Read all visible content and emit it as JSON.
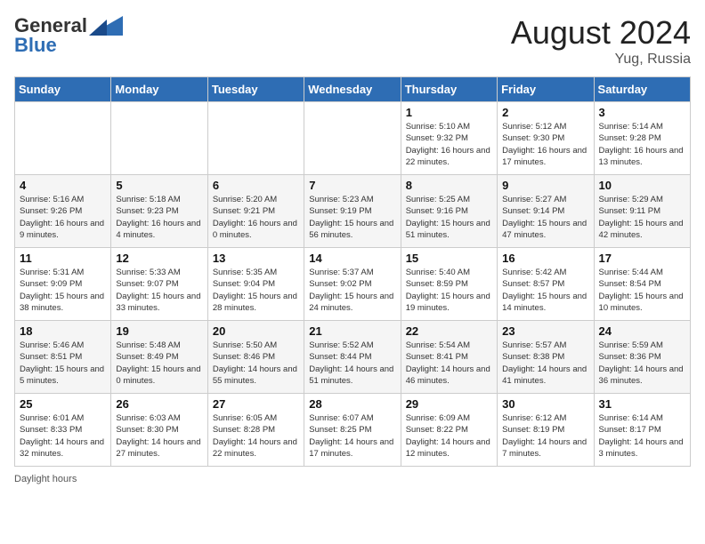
{
  "header": {
    "logo_general": "General",
    "logo_blue": "Blue",
    "month_year": "August 2024",
    "location": "Yug, Russia"
  },
  "days_of_week": [
    "Sunday",
    "Monday",
    "Tuesday",
    "Wednesday",
    "Thursday",
    "Friday",
    "Saturday"
  ],
  "weeks": [
    [
      {
        "day": "",
        "info": ""
      },
      {
        "day": "",
        "info": ""
      },
      {
        "day": "",
        "info": ""
      },
      {
        "day": "",
        "info": ""
      },
      {
        "day": "1",
        "info": "Sunrise: 5:10 AM\nSunset: 9:32 PM\nDaylight: 16 hours and 22 minutes."
      },
      {
        "day": "2",
        "info": "Sunrise: 5:12 AM\nSunset: 9:30 PM\nDaylight: 16 hours and 17 minutes."
      },
      {
        "day": "3",
        "info": "Sunrise: 5:14 AM\nSunset: 9:28 PM\nDaylight: 16 hours and 13 minutes."
      }
    ],
    [
      {
        "day": "4",
        "info": "Sunrise: 5:16 AM\nSunset: 9:26 PM\nDaylight: 16 hours and 9 minutes."
      },
      {
        "day": "5",
        "info": "Sunrise: 5:18 AM\nSunset: 9:23 PM\nDaylight: 16 hours and 4 minutes."
      },
      {
        "day": "6",
        "info": "Sunrise: 5:20 AM\nSunset: 9:21 PM\nDaylight: 16 hours and 0 minutes."
      },
      {
        "day": "7",
        "info": "Sunrise: 5:23 AM\nSunset: 9:19 PM\nDaylight: 15 hours and 56 minutes."
      },
      {
        "day": "8",
        "info": "Sunrise: 5:25 AM\nSunset: 9:16 PM\nDaylight: 15 hours and 51 minutes."
      },
      {
        "day": "9",
        "info": "Sunrise: 5:27 AM\nSunset: 9:14 PM\nDaylight: 15 hours and 47 minutes."
      },
      {
        "day": "10",
        "info": "Sunrise: 5:29 AM\nSunset: 9:11 PM\nDaylight: 15 hours and 42 minutes."
      }
    ],
    [
      {
        "day": "11",
        "info": "Sunrise: 5:31 AM\nSunset: 9:09 PM\nDaylight: 15 hours and 38 minutes."
      },
      {
        "day": "12",
        "info": "Sunrise: 5:33 AM\nSunset: 9:07 PM\nDaylight: 15 hours and 33 minutes."
      },
      {
        "day": "13",
        "info": "Sunrise: 5:35 AM\nSunset: 9:04 PM\nDaylight: 15 hours and 28 minutes."
      },
      {
        "day": "14",
        "info": "Sunrise: 5:37 AM\nSunset: 9:02 PM\nDaylight: 15 hours and 24 minutes."
      },
      {
        "day": "15",
        "info": "Sunrise: 5:40 AM\nSunset: 8:59 PM\nDaylight: 15 hours and 19 minutes."
      },
      {
        "day": "16",
        "info": "Sunrise: 5:42 AM\nSunset: 8:57 PM\nDaylight: 15 hours and 14 minutes."
      },
      {
        "day": "17",
        "info": "Sunrise: 5:44 AM\nSunset: 8:54 PM\nDaylight: 15 hours and 10 minutes."
      }
    ],
    [
      {
        "day": "18",
        "info": "Sunrise: 5:46 AM\nSunset: 8:51 PM\nDaylight: 15 hours and 5 minutes."
      },
      {
        "day": "19",
        "info": "Sunrise: 5:48 AM\nSunset: 8:49 PM\nDaylight: 15 hours and 0 minutes."
      },
      {
        "day": "20",
        "info": "Sunrise: 5:50 AM\nSunset: 8:46 PM\nDaylight: 14 hours and 55 minutes."
      },
      {
        "day": "21",
        "info": "Sunrise: 5:52 AM\nSunset: 8:44 PM\nDaylight: 14 hours and 51 minutes."
      },
      {
        "day": "22",
        "info": "Sunrise: 5:54 AM\nSunset: 8:41 PM\nDaylight: 14 hours and 46 minutes."
      },
      {
        "day": "23",
        "info": "Sunrise: 5:57 AM\nSunset: 8:38 PM\nDaylight: 14 hours and 41 minutes."
      },
      {
        "day": "24",
        "info": "Sunrise: 5:59 AM\nSunset: 8:36 PM\nDaylight: 14 hours and 36 minutes."
      }
    ],
    [
      {
        "day": "25",
        "info": "Sunrise: 6:01 AM\nSunset: 8:33 PM\nDaylight: 14 hours and 32 minutes."
      },
      {
        "day": "26",
        "info": "Sunrise: 6:03 AM\nSunset: 8:30 PM\nDaylight: 14 hours and 27 minutes."
      },
      {
        "day": "27",
        "info": "Sunrise: 6:05 AM\nSunset: 8:28 PM\nDaylight: 14 hours and 22 minutes."
      },
      {
        "day": "28",
        "info": "Sunrise: 6:07 AM\nSunset: 8:25 PM\nDaylight: 14 hours and 17 minutes."
      },
      {
        "day": "29",
        "info": "Sunrise: 6:09 AM\nSunset: 8:22 PM\nDaylight: 14 hours and 12 minutes."
      },
      {
        "day": "30",
        "info": "Sunrise: 6:12 AM\nSunset: 8:19 PM\nDaylight: 14 hours and 7 minutes."
      },
      {
        "day": "31",
        "info": "Sunrise: 6:14 AM\nSunset: 8:17 PM\nDaylight: 14 hours and 3 minutes."
      }
    ]
  ],
  "footer": {
    "daylight_label": "Daylight hours"
  }
}
